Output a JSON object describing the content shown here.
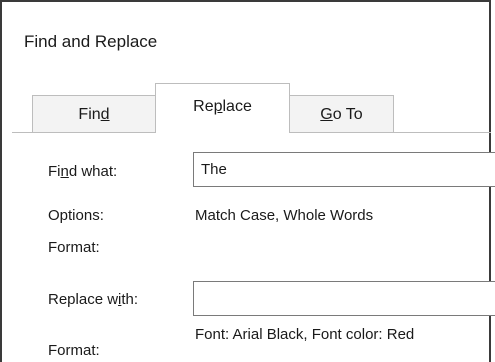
{
  "dialog": {
    "title": "Find and Replace"
  },
  "tabs": {
    "find": {
      "pre": "Fin",
      "key": "d",
      "post": ""
    },
    "replace": {
      "pre": "Re",
      "key": "p",
      "post": "lace"
    },
    "goto": {
      "pre": "",
      "key": "G",
      "post": "o To"
    }
  },
  "find_section": {
    "label_pre": "Fi",
    "label_key": "n",
    "label_post": "d what:",
    "value": "The",
    "options_label": "Options:",
    "options_value": "Match Case, Whole Words",
    "format_label": "Format:"
  },
  "replace_section": {
    "label_pre": "Replace w",
    "label_key": "i",
    "label_post": "th:",
    "value": "",
    "format_label": "Format:",
    "format_value": "Font: Arial Black, Font color: Red"
  }
}
